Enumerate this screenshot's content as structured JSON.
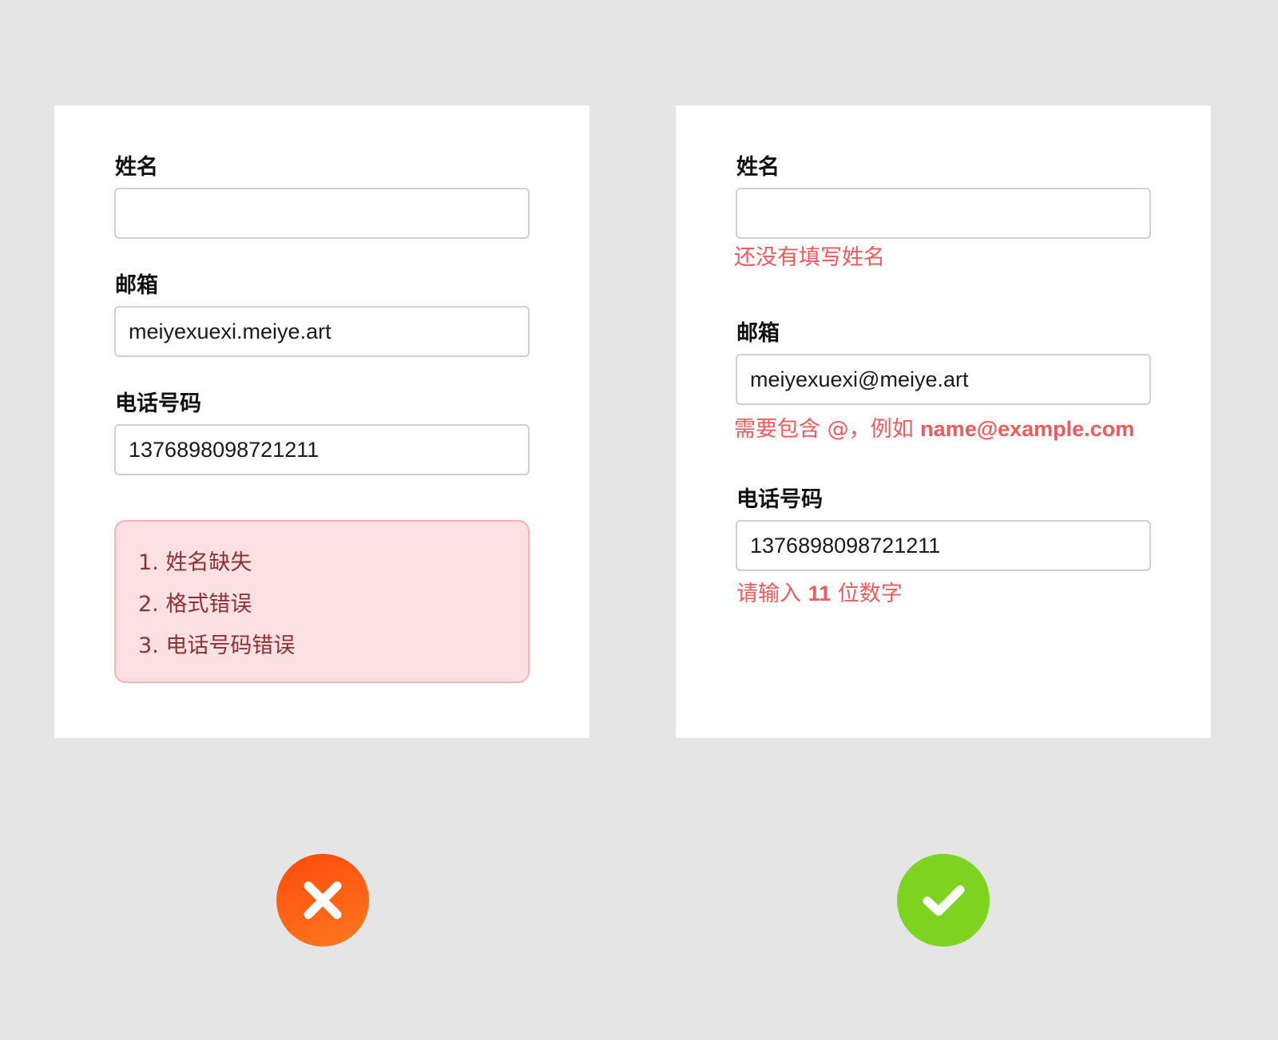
{
  "bad_example": {
    "fields": [
      {
        "label": "姓名",
        "value": ""
      },
      {
        "label": "邮箱",
        "value": "meiyexuexi.meiye.art"
      },
      {
        "label": "电话号码",
        "value": "1376898098721211"
      }
    ],
    "error_summary": [
      "1. 姓名缺失",
      "2. 格式错误",
      "3. 电话号码错误"
    ],
    "verdict_icon": "close-icon",
    "verdict_color": "#ff5a14"
  },
  "good_example": {
    "fields": [
      {
        "label": "姓名",
        "value": "",
        "error": "还没有填写姓名"
      },
      {
        "label": "邮箱",
        "value": "meiyexuexi@meiye.art",
        "error_prefix": "需要包含 @，例如 ",
        "error_strong": "name@example.com"
      },
      {
        "label": "电话号码",
        "value": "1376898098721211",
        "error_prefix": "请输入 ",
        "error_strong": "11",
        "error_suffix": " 位数字"
      }
    ],
    "verdict_icon": "check-icon",
    "verdict_color": "#7ed321"
  },
  "colors": {
    "background": "#e5e5e5",
    "error_text": "#f05a5e",
    "summary_background": "#fde1e2",
    "summary_border": "#f7b2b4",
    "summary_text": "#8a3236"
  }
}
